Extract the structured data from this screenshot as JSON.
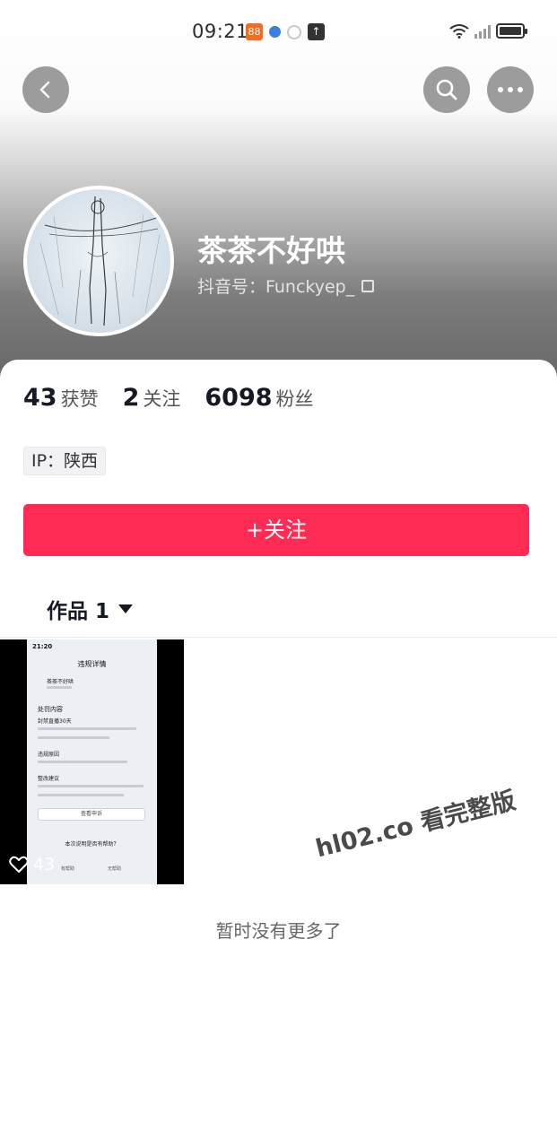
{
  "status_bar": {
    "time": "09:21",
    "app_icons": [
      "app-icon",
      "browser-icon",
      "nfc-icon",
      "upload-icon"
    ],
    "right_icons": [
      "wifi-icon",
      "signal-icon",
      "battery-icon"
    ]
  },
  "top_nav": {
    "back_icon": "chevron-left-icon",
    "search_icon": "search-icon",
    "more_icon": "more-horizontal-icon"
  },
  "profile": {
    "nickname": "茶茶不好哄",
    "account_id": "抖音号：Funckyep_"
  },
  "stats": [
    {
      "value": "43",
      "label": "获赞"
    },
    {
      "value": "2",
      "label": "关注"
    },
    {
      "value": "6098",
      "label": "粉丝"
    }
  ],
  "ip_tag": "IP：陕西",
  "follow_button": "+关注",
  "works_tab": "作品 1",
  "video": {
    "likes": "43",
    "screen_time": "21:20",
    "screen_title": "违规详情",
    "screen_name": "茶茶不好哄",
    "screen_section": "处罚内容",
    "screen_duration": "封禁直播30天",
    "screen_reason": "违规原因",
    "screen_advice": "整改建议",
    "screen_button": "查看申诉",
    "screen_feedback": "本次说明是否有帮助？",
    "screen_yes": "有帮助",
    "screen_no": "无帮助"
  },
  "footer_text": "暂时没有更多了",
  "watermark": "hl02.co 看完整版",
  "colors": {
    "accent": "#fe2c55",
    "text_primary": "#161823",
    "nav_button_bg": "#9c9c9c"
  }
}
